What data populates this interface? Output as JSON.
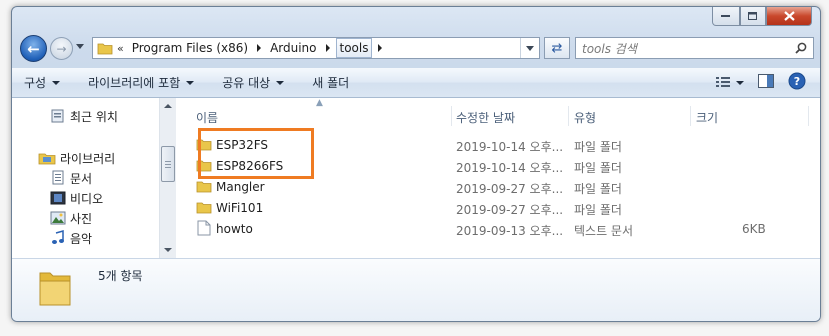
{
  "colors": {
    "accent_highlight": "#ef7b22",
    "folder": "#e9c64a",
    "header_text": "#4c607a"
  },
  "window": {
    "caption_buttons": [
      "minimize",
      "maximize",
      "close"
    ]
  },
  "nav": {
    "back_icon": "back-arrow-icon",
    "forward_icon": "forward-arrow-icon",
    "breadcrumb_prefix": "«",
    "breadcrumbs": [
      "Program Files (x86)",
      "Arduino",
      "tools"
    ],
    "search_placeholder": "tools 검색"
  },
  "toolbar": {
    "organize": "구성",
    "include_library": "라이브러리에 포함",
    "share_with": "공유 대상",
    "new_folder": "새 폴더"
  },
  "sidebar": {
    "recent": "최근 위치",
    "libraries": "라이브러리",
    "documents": "문서",
    "videos": "비디오",
    "pictures": "사진",
    "music": "음악"
  },
  "columns": {
    "name": "이름",
    "modified": "수정한 날짜",
    "type": "유형",
    "size": "크기"
  },
  "files": [
    {
      "name": "ESP32FS",
      "modified": "2019-10-14 오후...",
      "type": "파일 폴더",
      "size": "",
      "kind": "folder"
    },
    {
      "name": "ESP8266FS",
      "modified": "2019-10-14 오후...",
      "type": "파일 폴더",
      "size": "",
      "kind": "folder"
    },
    {
      "name": "Mangler",
      "modified": "2019-09-27 오후...",
      "type": "파일 폴더",
      "size": "",
      "kind": "folder"
    },
    {
      "name": "WiFi101",
      "modified": "2019-09-27 오후...",
      "type": "파일 폴더",
      "size": "",
      "kind": "folder"
    },
    {
      "name": "howto",
      "modified": "2019-09-13 오후...",
      "type": "텍스트 문서",
      "size": "6KB",
      "kind": "text"
    }
  ],
  "details": {
    "count": "5개 항목"
  }
}
